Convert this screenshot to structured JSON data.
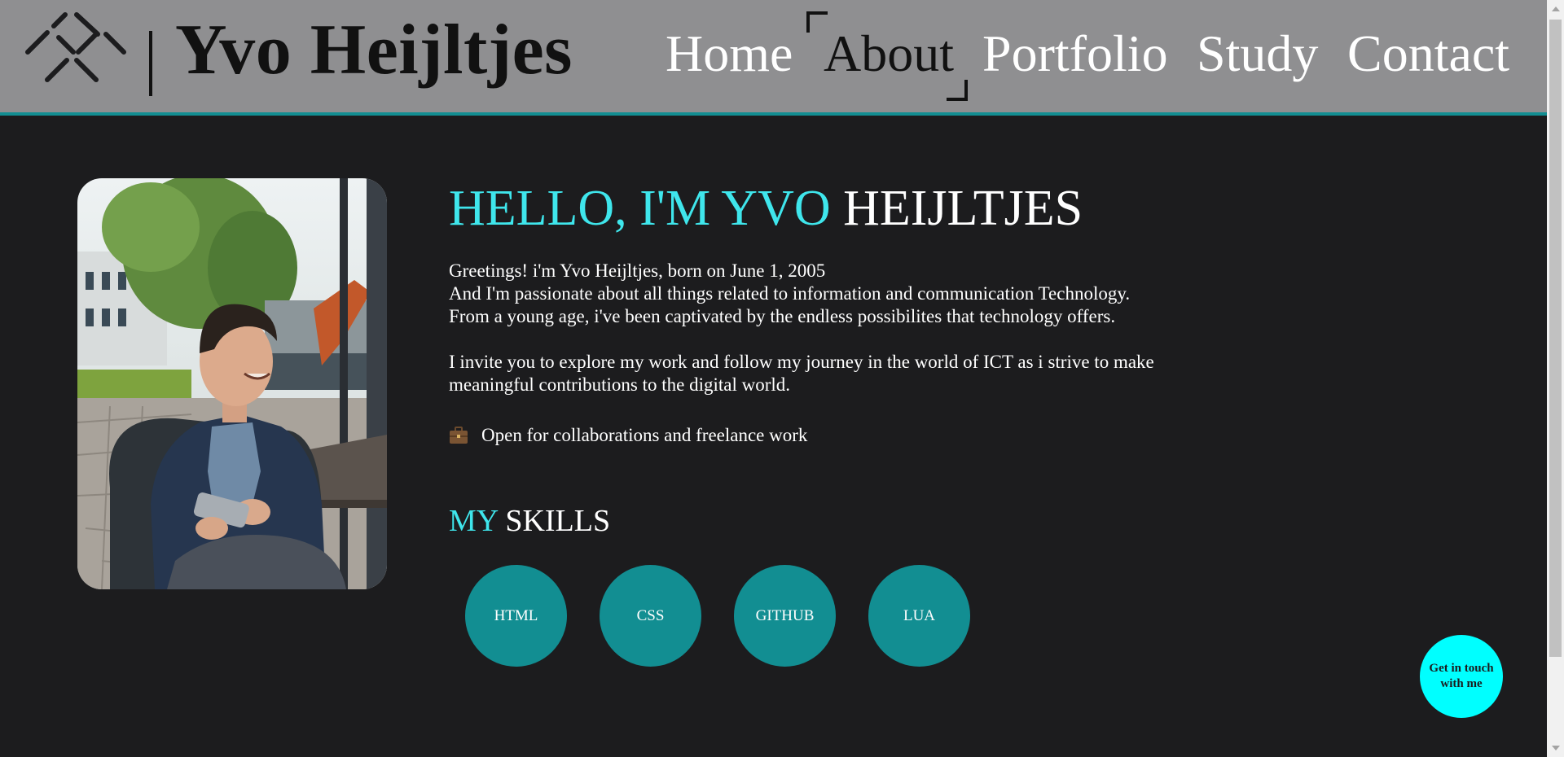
{
  "header": {
    "brand_name": "| Yvo Heijltjes",
    "logo_icon": "x-lattice-logo",
    "nav": [
      {
        "label": "Home",
        "active": false
      },
      {
        "label": "About",
        "active": true
      },
      {
        "label": "Portfolio",
        "active": false
      },
      {
        "label": "Study",
        "active": false
      },
      {
        "label": "Contact",
        "active": false
      }
    ]
  },
  "hero": {
    "title_accent": "HELLO, I'M YVO",
    "title_rest": " HEIJLTJES",
    "bio_lines": [
      "Greetings! i'm Yvo Heijltjes, born on June 1, 2005",
      "And I'm passionate about all things related to information and communication Technology.",
      "From a young age, i've been captivated by the endless possibilites that technology offers.",
      "I invite you to explore my work and follow my journey in the world of ICT as i strive to make meaningful contributions to the digital world."
    ],
    "collab_icon": "briefcase-icon",
    "collab_text": "Open for collaborations and freelance work"
  },
  "skills": {
    "title_accent": "MY",
    "title_rest": " SKILLS",
    "items": [
      "HTML",
      "CSS",
      "GITHUB",
      "LUA"
    ]
  },
  "cta": {
    "label": "Get in touch with me"
  },
  "colors": {
    "header_bg": "#8f8f91",
    "page_bg": "#1c1c1e",
    "accent": "#3fe6ec",
    "skill_bg": "#128e92",
    "cta_bg": "#00ffff"
  }
}
